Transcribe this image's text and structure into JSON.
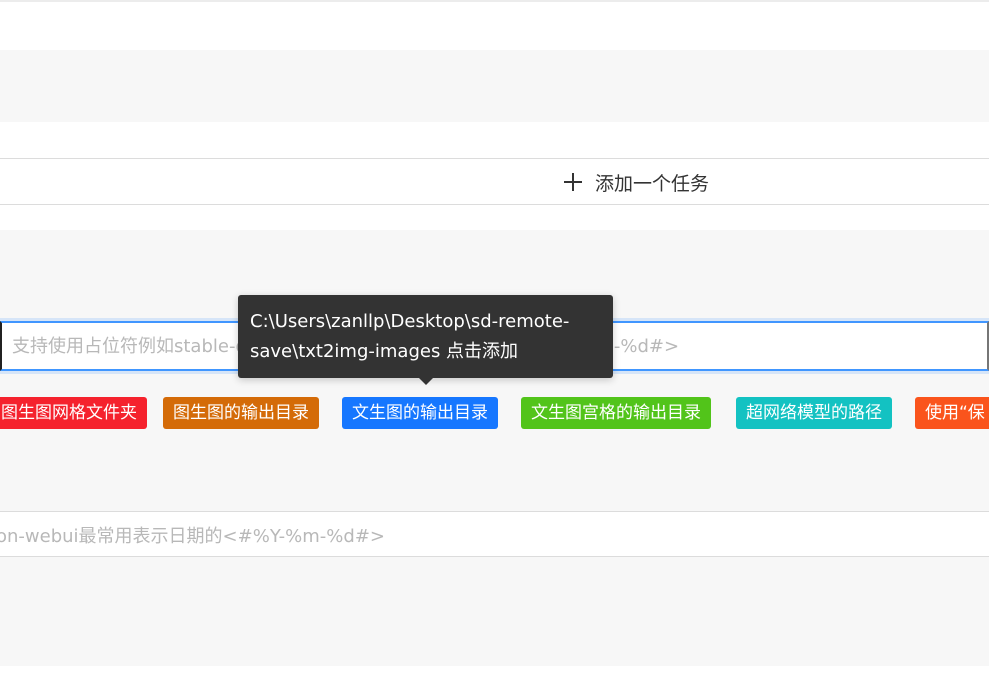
{
  "add_task": {
    "label": "添加一个任务"
  },
  "path_input": {
    "placeholder": "支持使用占位符例如stable-diffusion-webui最常用表示日期的<#%Y-%m-%d#>"
  },
  "tags": [
    {
      "label": "图生图网格文件夹",
      "color": "#f5222d"
    },
    {
      "label": "图生图的输出目录",
      "color": "#d46b08"
    },
    {
      "label": "文生图的输出目录",
      "color": "#1677ff"
    },
    {
      "label": "文生图宫格的输出目录",
      "color": "#52c41a"
    },
    {
      "label": "超网络模型的路径",
      "color": "#13c2c2"
    },
    {
      "label": "使用“保",
      "color": "#fa541c"
    }
  ],
  "second_input": {
    "placeholder": "on-webui最常用表示日期的<#%Y-%m-%d#>"
  },
  "tooltip": {
    "text": "C:\\Users\\zanllp\\Desktop\\sd-remote-save\\txt2img-images 点击添加"
  }
}
